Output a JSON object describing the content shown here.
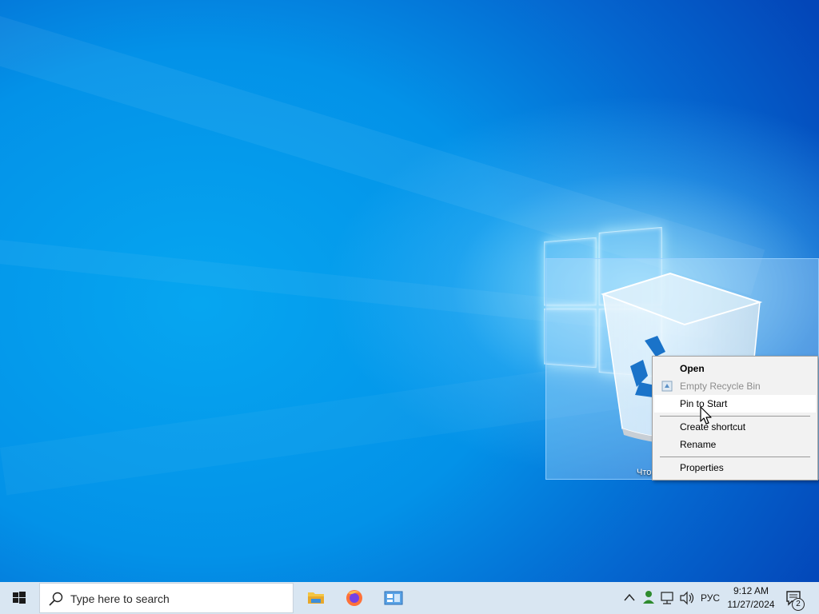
{
  "desktop": {
    "recycle_bin_label": "Что"
  },
  "context_menu": {
    "items": [
      {
        "label": "Open",
        "bold": true
      },
      {
        "label": "Empty Recycle Bin",
        "disabled": true
      },
      {
        "label": "Pin to Start",
        "hovered": true
      },
      {
        "label": "Create shortcut"
      },
      {
        "label": "Rename"
      },
      {
        "label": "Properties"
      }
    ]
  },
  "taskbar": {
    "search_placeholder": "Type here to search",
    "apps": [
      "file-explorer-icon",
      "firefox-icon",
      "control-panel-icon"
    ],
    "tray": {
      "language": "РУС",
      "time": "9:12 AM",
      "date": "11/27/2024",
      "notification_count": "2"
    }
  },
  "colors": {
    "accent": "#0078d7",
    "taskbar_bg": "#d9e6f2",
    "menu_bg": "#f2f2f2"
  }
}
